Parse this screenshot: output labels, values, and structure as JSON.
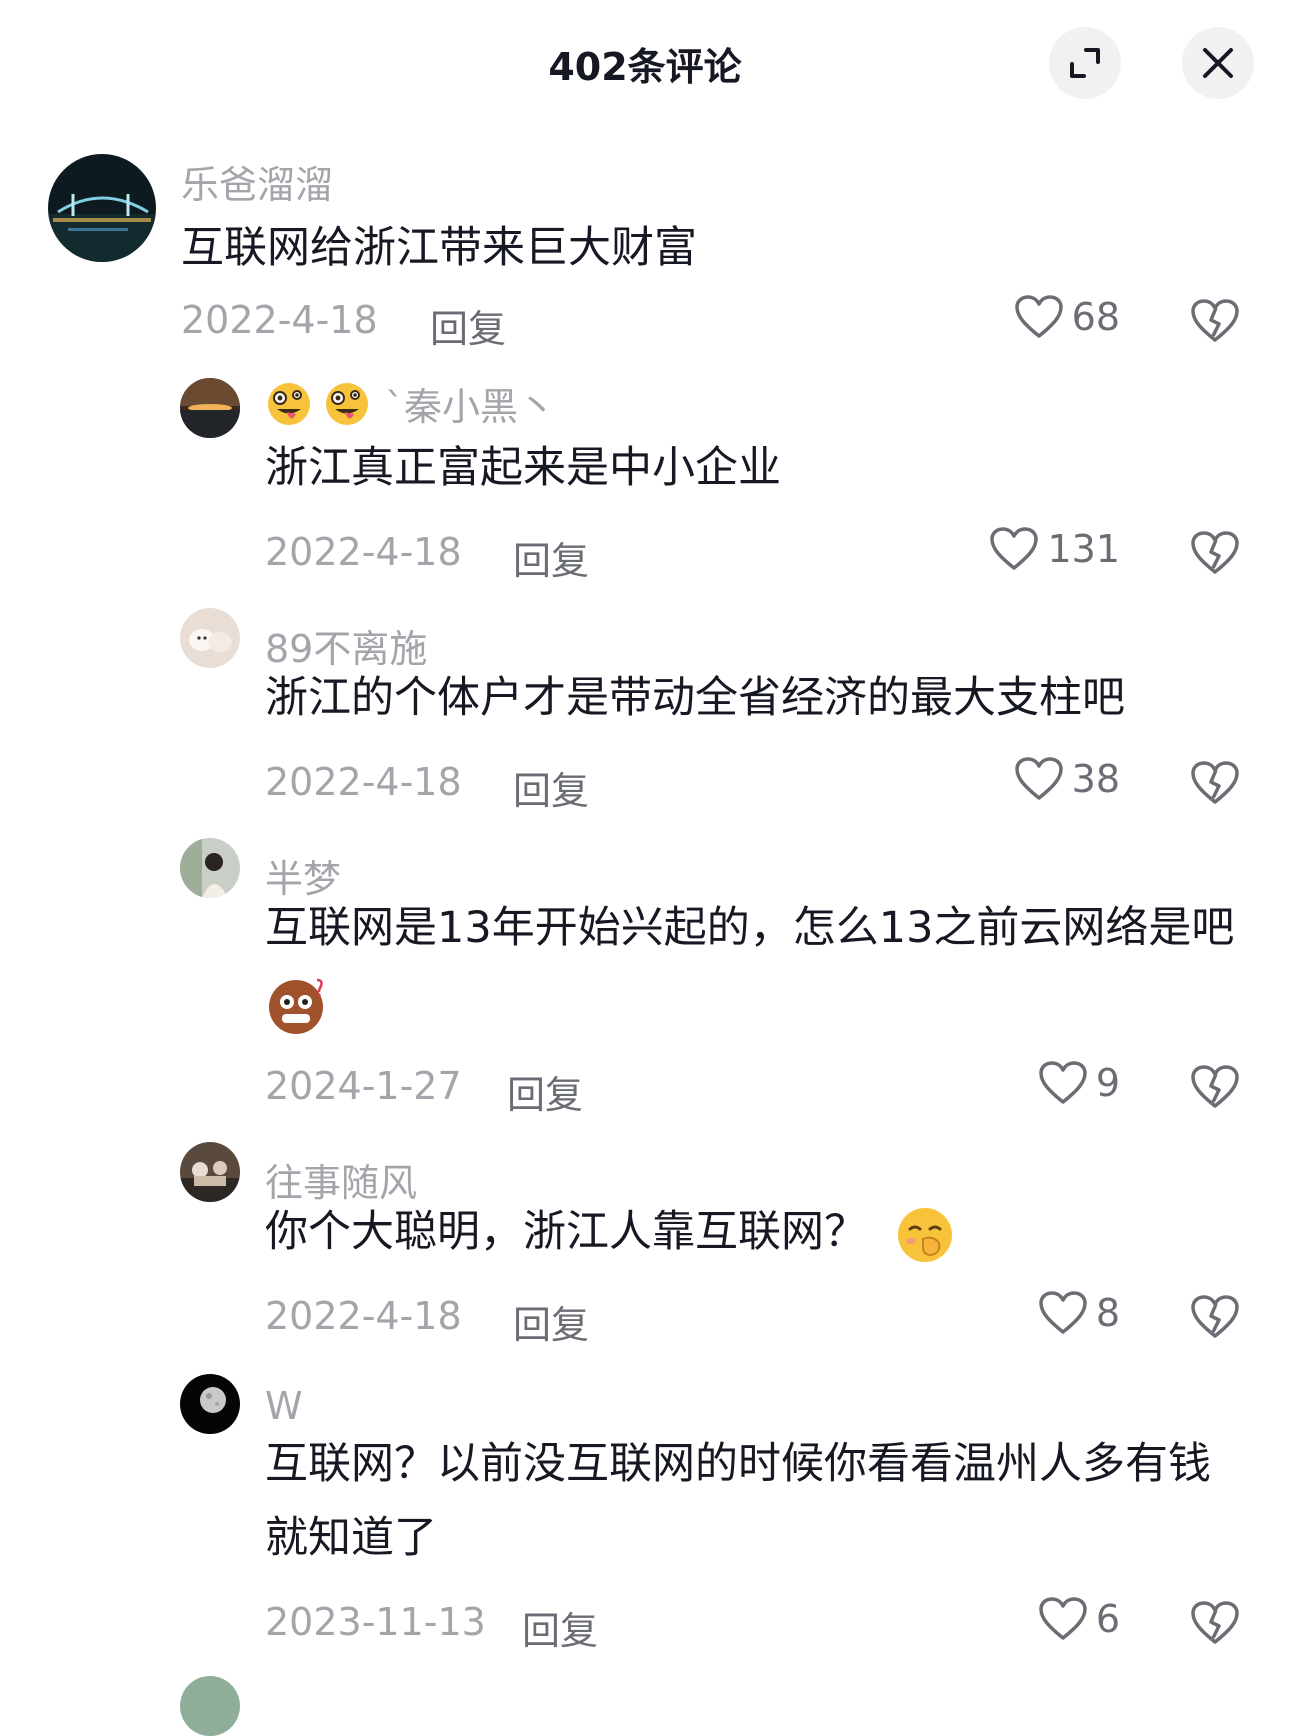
{
  "header": {
    "title": "402条评论"
  },
  "comments": [
    {
      "username": "乐爸溜溜",
      "text": "互联网给浙江带来巨大财富",
      "date": "2022-4-18",
      "reply": "回复",
      "likes": "68"
    },
    {
      "username": "`秦小黑丶",
      "text": "浙江真正富起来是中小企业",
      "date": "2022-4-18",
      "reply": "回复",
      "likes": "131"
    },
    {
      "username": "89不离施",
      "text": "浙江的个体户才是带动全省经济的最大支柱吧",
      "date": "2022-4-18",
      "reply": "回复",
      "likes": "38"
    },
    {
      "username": "半梦",
      "text": "互联网是13年开始兴起的，怎么13之前云网络是吧",
      "date": "2024-1-27",
      "reply": "回复",
      "likes": "9"
    },
    {
      "username": "往事随风",
      "text": "你个大聪明，浙江人靠互联网？",
      "date": "2022-4-18",
      "reply": "回复",
      "likes": "8"
    },
    {
      "username": "W",
      "text_line1": "互联网？以前没互联网的时候你看看温州人多有钱",
      "text_line2": "就知道了",
      "date": "2023-11-13",
      "reply": "回复",
      "likes": "6"
    }
  ]
}
